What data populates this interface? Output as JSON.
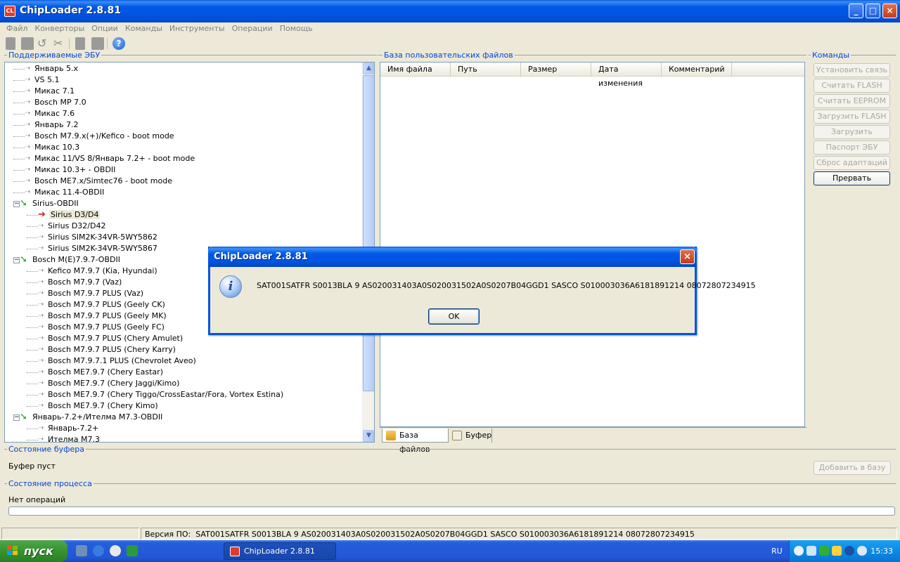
{
  "window": {
    "title": "ChipLoader 2.8.81",
    "app_icon": "CL"
  },
  "menu": [
    "Файл",
    "Конверторы",
    "Опции",
    "Команды",
    "Инструменты",
    "Операции",
    "Помощь"
  ],
  "toolbar": {
    "help_glyph": "?"
  },
  "ecu_panel": {
    "label": "Поддерживаемые ЭБУ"
  },
  "tree": [
    {
      "text": "Январь 5.x",
      "level": 0,
      "kind": "leaf"
    },
    {
      "text": "VS 5.1",
      "level": 0,
      "kind": "leaf"
    },
    {
      "text": "Микас 7.1",
      "level": 0,
      "kind": "leaf"
    },
    {
      "text": "Bosch MP 7.0",
      "level": 0,
      "kind": "leaf"
    },
    {
      "text": "Микас 7.6",
      "level": 0,
      "kind": "leaf"
    },
    {
      "text": "Январь 7.2",
      "level": 0,
      "kind": "leaf"
    },
    {
      "text": "Bosch M7.9.x(+)/Kefico - boot mode",
      "level": 0,
      "kind": "leaf"
    },
    {
      "text": "Микас 10.3",
      "level": 0,
      "kind": "leaf"
    },
    {
      "text": "Микас 11/VS 8/Январь 7.2+ - boot mode",
      "level": 0,
      "kind": "leaf"
    },
    {
      "text": "Микас 10.3+ - OBDII",
      "level": 0,
      "kind": "leaf"
    },
    {
      "text": "Bosch ME7.x/Simtec76 - boot mode",
      "level": 0,
      "kind": "leaf"
    },
    {
      "text": "Микас 11.4-OBDII",
      "level": 0,
      "kind": "leaf"
    },
    {
      "text": "Sirius-OBDII",
      "level": 0,
      "kind": "group"
    },
    {
      "text": "Sirius D3/D4",
      "level": 1,
      "kind": "selected"
    },
    {
      "text": "Sirius D32/D42",
      "level": 1,
      "kind": "leaf"
    },
    {
      "text": "Sirius SIM2K-34VR-5WY5862",
      "level": 1,
      "kind": "leaf"
    },
    {
      "text": "Sirius SIM2K-34VR-5WY5867",
      "level": 1,
      "kind": "leaf"
    },
    {
      "text": "Bosch M(E)7.9.7-OBDII",
      "level": 0,
      "kind": "group"
    },
    {
      "text": "Kefico M7.9.7 (Kia, Hyundai)",
      "level": 1,
      "kind": "leaf"
    },
    {
      "text": "Bosch M7.9.7 (Vaz)",
      "level": 1,
      "kind": "leaf"
    },
    {
      "text": "Bosch M7.9.7 PLUS (Vaz)",
      "level": 1,
      "kind": "leaf"
    },
    {
      "text": "Bosch M7.9.7 PLUS (Geely CK)",
      "level": 1,
      "kind": "leaf"
    },
    {
      "text": "Bosch M7.9.7 PLUS (Geely MK)",
      "level": 1,
      "kind": "leaf"
    },
    {
      "text": "Bosch M7.9.7 PLUS (Geely FC)",
      "level": 1,
      "kind": "leaf"
    },
    {
      "text": "Bosch M7.9.7 PLUS (Chery Amulet)",
      "level": 1,
      "kind": "leaf"
    },
    {
      "text": "Bosch M7.9.7 PLUS (Chery Karry)",
      "level": 1,
      "kind": "leaf"
    },
    {
      "text": "Bosch M7.9.7.1 PLUS (Chevrolet Aveo)",
      "level": 1,
      "kind": "leaf"
    },
    {
      "text": "Bosch ME7.9.7 (Chery Eastar)",
      "level": 1,
      "kind": "leaf"
    },
    {
      "text": "Bosch ME7.9.7 (Chery Jaggi/Kimo)",
      "level": 1,
      "kind": "leaf"
    },
    {
      "text": "Bosch ME7.9.7 (Chery Tiggo/CrossEastar/Fora, Vortex Estina)",
      "level": 1,
      "kind": "leaf"
    },
    {
      "text": "Bosch ME7.9.7 (Chery Kimo)",
      "level": 1,
      "kind": "leaf"
    },
    {
      "text": "Январь-7.2+/Ителма M7.3-OBDII",
      "level": 0,
      "kind": "group"
    },
    {
      "text": "Январь-7.2+",
      "level": 1,
      "kind": "leaf"
    },
    {
      "text": "Ителма M7.3",
      "level": 1,
      "kind": "leaf"
    }
  ],
  "files_panel": {
    "label": "База пользовательских файлов",
    "columns": [
      "Имя файла",
      "Путь",
      "Размер",
      "Дата изменения",
      "Комментарий"
    ],
    "tabs": [
      "База файлов",
      "Буфер"
    ]
  },
  "commands": {
    "label": "Команды",
    "buttons": [
      {
        "label": "Установить связь",
        "enabled": false
      },
      {
        "label": "Считать FLASH",
        "enabled": false
      },
      {
        "label": "Считать EEPROM",
        "enabled": false
      },
      {
        "label": "Загрузить FLASH",
        "enabled": false
      },
      {
        "label": "Загрузить EEPROM",
        "enabled": false
      },
      {
        "label": "Паспорт ЭБУ",
        "enabled": false
      },
      {
        "label": "Сброс адаптаций",
        "enabled": false
      },
      {
        "label": "Прервать",
        "enabled": true
      }
    ]
  },
  "buffer": {
    "label": "Состояние буфера",
    "status": "Буфер пуст",
    "add_button": "Добавить в базу"
  },
  "process": {
    "label": "Состояние процесса",
    "status": "Нет операций",
    "progress": 0
  },
  "statusbar": {
    "version_label": "Версия ПО:",
    "version_value": "SAT001SATFR S0013BLA 9 AS020031403A0S020031502A0S0207B04GGD1 SASCO S010003036A6181891214 08072807234915"
  },
  "dialog": {
    "title": "ChipLoader 2.8.81",
    "message": "SAT001SATFR S0013BLA 9 AS020031403A0S020031502A0S0207B04GGD1 SASCO S010003036A6181891214 08072807234915",
    "ok_label": "OK",
    "icon": "info-icon"
  },
  "taskbar": {
    "start_label": "пуск",
    "task_label": "ChipLoader 2.8.81",
    "lang": "RU",
    "clock": "15:33"
  }
}
